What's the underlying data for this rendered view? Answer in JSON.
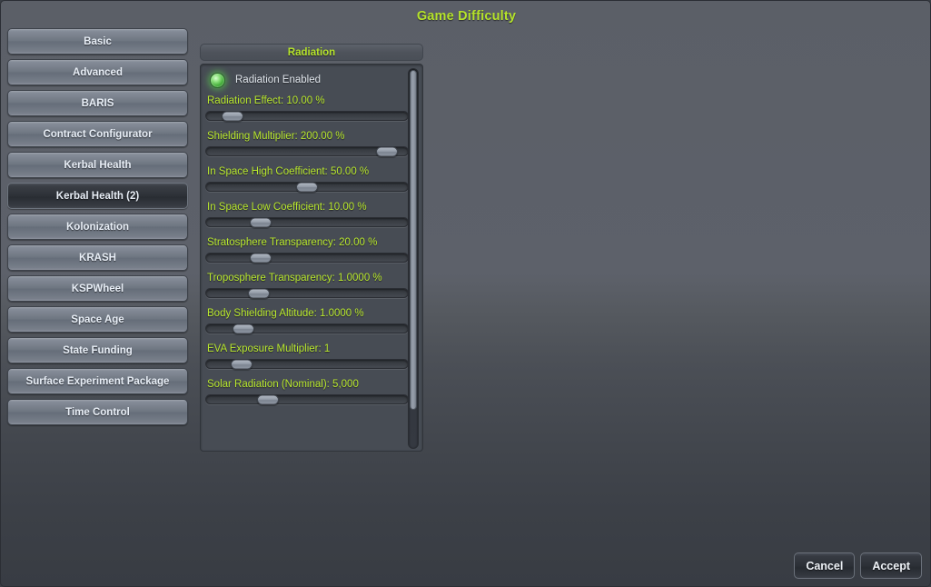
{
  "window": {
    "title": "Game Difficulty"
  },
  "sidebar": {
    "items": [
      {
        "label": "Basic",
        "selected": false
      },
      {
        "label": "Advanced",
        "selected": false
      },
      {
        "label": "BARIS",
        "selected": false
      },
      {
        "label": "Contract Configurator",
        "selected": false
      },
      {
        "label": "Kerbal Health",
        "selected": false
      },
      {
        "label": "Kerbal Health (2)",
        "selected": true
      },
      {
        "label": "Kolonization",
        "selected": false
      },
      {
        "label": "KRASH",
        "selected": false
      },
      {
        "label": "KSPWheel",
        "selected": false
      },
      {
        "label": "Space Age",
        "selected": false
      },
      {
        "label": "State Funding",
        "selected": false
      },
      {
        "label": "Surface Experiment Package",
        "selected": false
      },
      {
        "label": "Time Control",
        "selected": false
      }
    ]
  },
  "panel": {
    "header_title": "Radiation",
    "toggle": {
      "label": "Radiation Enabled",
      "enabled": true,
      "color": "#5cdc50"
    },
    "settings": [
      {
        "label": "Radiation Effect: 10.00 %",
        "handle_pct": 8
      },
      {
        "label": "Shielding Multiplier: 200.00 %",
        "handle_pct": 95
      },
      {
        "label": "In Space High Coefficient: 50.00 %",
        "handle_pct": 50
      },
      {
        "label": "In Space Low Coefficient: 10.00 %",
        "handle_pct": 24
      },
      {
        "label": "Stratosphere Transparency: 20.00 %",
        "handle_pct": 24
      },
      {
        "label": "Troposphere Transparency: 1.0000 %",
        "handle_pct": 23
      },
      {
        "label": "Body Shielding Altitude: 1.0000 %",
        "handle_pct": 14
      },
      {
        "label": "EVA Exposure Multiplier: 1",
        "handle_pct": 13
      },
      {
        "label": "Solar Radiation (Nominal): 5,000",
        "handle_pct": 28
      }
    ]
  },
  "footer": {
    "cancel_label": "Cancel",
    "accept_label": "Accept"
  },
  "colors": {
    "accent_green": "#b5e32b",
    "label_green": "#b9e82e",
    "text_light": "#e8eef6"
  }
}
